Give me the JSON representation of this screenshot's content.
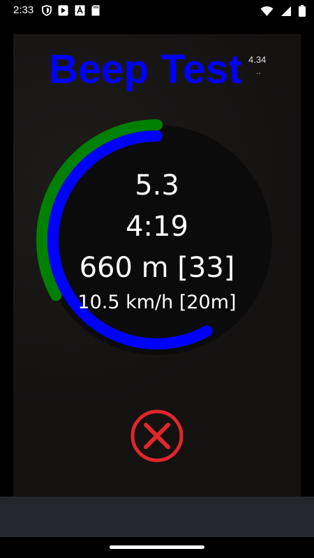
{
  "status_bar": {
    "time": "2:33",
    "left_icons": [
      "shield-icon",
      "play-store-icon",
      "a-box-icon",
      "sd-card-icon"
    ],
    "right_icons": [
      "wifi-icon",
      "signal-icon",
      "battery-icon"
    ]
  },
  "app": {
    "title": "Beep Test",
    "version": "4.34",
    "version_sub": ".."
  },
  "readout": {
    "level": "5.3",
    "time": "4:19",
    "distance": "660 m [33]",
    "speed": "10.5 km/h [20m]"
  },
  "progress": {
    "level_progress": 0.33,
    "shuttle_progress": 0.58
  },
  "colors": {
    "title": "#0000ff",
    "level_arc": "#008000",
    "shuttle_arc": "#0000ff",
    "stop": "#e0262b",
    "background": "#141211",
    "bottom_bar": "#23272e"
  },
  "controls": {
    "stop_icon": "close-icon"
  }
}
